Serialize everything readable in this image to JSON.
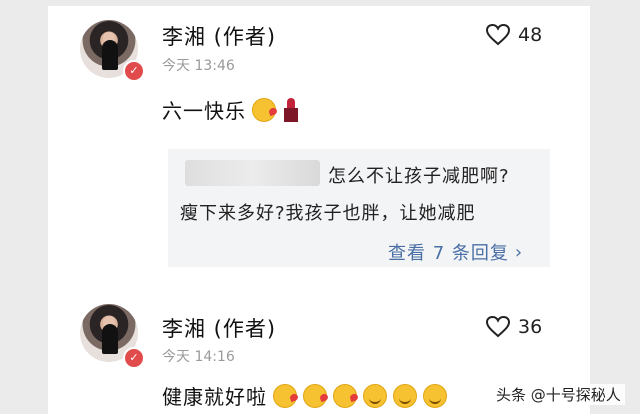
{
  "comments": [
    {
      "author": "李湘 (作者)",
      "time": "今天 13:46",
      "likes": "48",
      "text": "六一快乐",
      "emojis": [
        "wink-emoji",
        "lipstick-emoji"
      ]
    },
    {
      "author": "李湘 (作者)",
      "time": "今天 14:16",
      "likes": "36",
      "text": "健康就好啦",
      "emojis": [
        "kiss-emoji",
        "kiss-emoji",
        "kiss-emoji",
        "smile-emoji",
        "smile-emoji",
        "smile-emoji"
      ]
    }
  ],
  "reply": {
    "line1": "怎么不让孩子减肥啊?",
    "line2": "瘦下来多好?我孩子也胖，让她减肥",
    "view_replies": "查看 7 条回复"
  },
  "watermark": "头条 @十号探秘人",
  "colors": {
    "background": "#ebebeb",
    "reply_bg": "#f3f4f6",
    "link": "#4a6fa5",
    "badge": "#e14b4b"
  }
}
